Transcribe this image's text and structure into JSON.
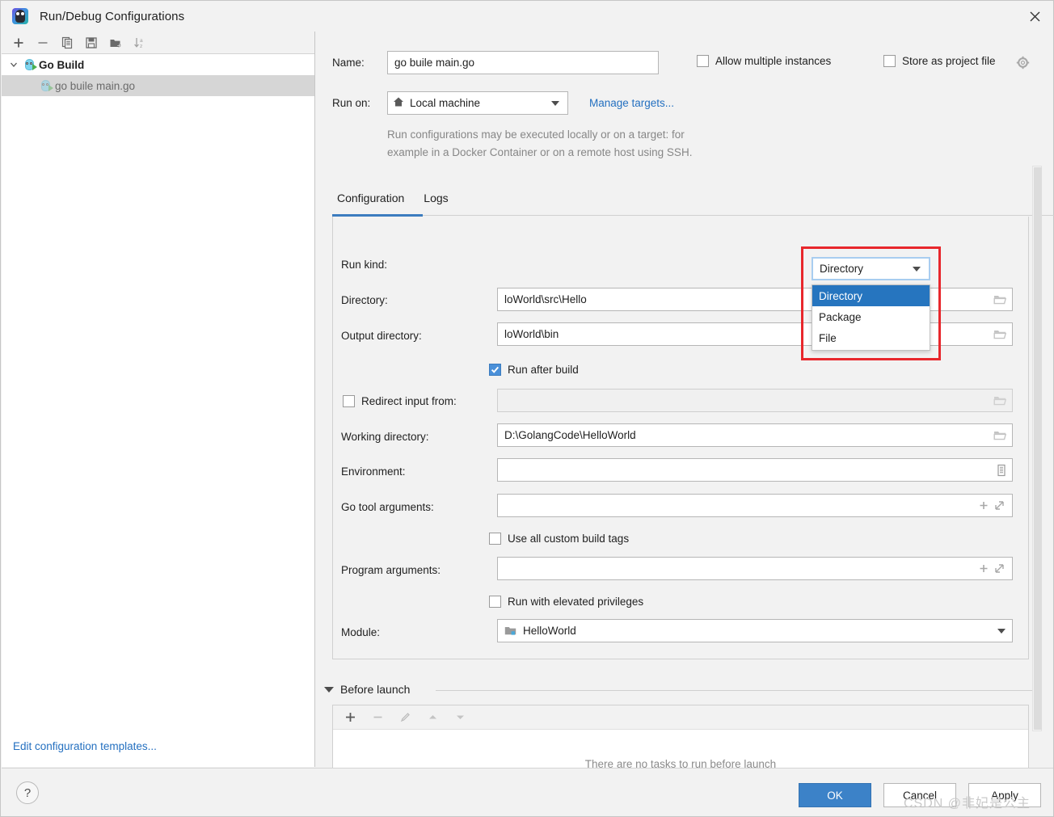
{
  "window": {
    "title": "Run/Debug Configurations",
    "app_icon": "go-goland-icon",
    "close_label": "×"
  },
  "sidebar": {
    "toolbar": [
      {
        "name": "add-configuration-button",
        "icon": "plus-icon"
      },
      {
        "name": "remove-configuration-button",
        "icon": "minus-icon"
      },
      {
        "name": "copy-configuration-button",
        "icon": "copy-icon"
      },
      {
        "name": "save-configuration-button",
        "icon": "save-icon"
      },
      {
        "name": "move-into-folder-button",
        "icon": "folder-add-icon"
      },
      {
        "name": "sort-configurations-button",
        "icon": "sort-alpha-icon"
      }
    ],
    "tree": [
      {
        "label": "Go Build",
        "icon": "go-build-icon",
        "group": true,
        "expanded": true,
        "selected": false
      },
      {
        "label": "go buile main.go",
        "icon": "go-run-icon",
        "group": false,
        "selected": true
      }
    ],
    "edit_templates_link": "Edit configuration templates..."
  },
  "form": {
    "name_label": "Name:",
    "name_value": "go buile main.go",
    "allow_multiple_label": "Allow multiple instances",
    "allow_multiple_checked": false,
    "store_project_label": "Store as project file",
    "store_project_checked": false,
    "gear_icon": "gear-icon",
    "run_on_label": "Run on:",
    "run_on_value": "Local machine",
    "run_on_icon": "home-icon",
    "manage_targets_link": "Manage targets...",
    "hint_line1": "Run configurations may be executed locally or on a target: for",
    "hint_line2": "example in a Docker Container or on a remote host using SSH."
  },
  "tabs": [
    {
      "label": "Configuration",
      "active": true
    },
    {
      "label": "Logs",
      "active": false
    }
  ],
  "configuration": {
    "run_kind_label": "Run kind:",
    "run_kind_value": "Directory",
    "run_kind_options": [
      {
        "label": "Directory",
        "selected": true
      },
      {
        "label": "Package",
        "selected": false
      },
      {
        "label": "File",
        "selected": false
      }
    ],
    "directory_label": "Directory:",
    "directory_value": "loWorld\\src\\Hello",
    "output_directory_label": "Output directory:",
    "output_directory_value": "loWorld\\bin",
    "run_after_build_label": "Run after build",
    "run_after_build_checked": true,
    "redirect_input_label": "Redirect input from:",
    "redirect_input_checked": false,
    "redirect_input_value": "",
    "working_directory_label": "Working directory:",
    "working_directory_value": "D:\\GolangCode\\HelloWorld",
    "environment_label": "Environment:",
    "environment_value": "",
    "go_tool_args_label": "Go tool arguments:",
    "go_tool_args_value": "",
    "build_tags_label": "Use all custom build tags",
    "build_tags_checked": false,
    "program_args_label": "Program arguments:",
    "program_args_value": "",
    "elevated_label": "Run with elevated privileges",
    "elevated_checked": false,
    "module_label": "Module:",
    "module_value": "HelloWorld",
    "module_icon": "module-folder-icon"
  },
  "before_launch": {
    "title": "Before launch",
    "expanded": true,
    "toolbar": [
      {
        "name": "add-task-button",
        "icon": "plus-icon"
      },
      {
        "name": "remove-task-button",
        "icon": "minus-icon"
      },
      {
        "name": "edit-task-button",
        "icon": "pencil-icon"
      },
      {
        "name": "move-up-button",
        "icon": "arrow-up-icon"
      },
      {
        "name": "move-down-button",
        "icon": "arrow-down-icon"
      }
    ],
    "empty_text": "There are no tasks to run before launch"
  },
  "footer": {
    "help_label": "?",
    "ok_label": "OK",
    "cancel_label": "Cancel",
    "apply_label": "Apply"
  },
  "watermark": "CSDN @非妃是公主",
  "colors": {
    "accent": "#3c82c8",
    "link": "#2470c0",
    "highlight_box": "#e8272c",
    "selection": "#2675bf",
    "tab_underline": "#3c7cbf"
  }
}
